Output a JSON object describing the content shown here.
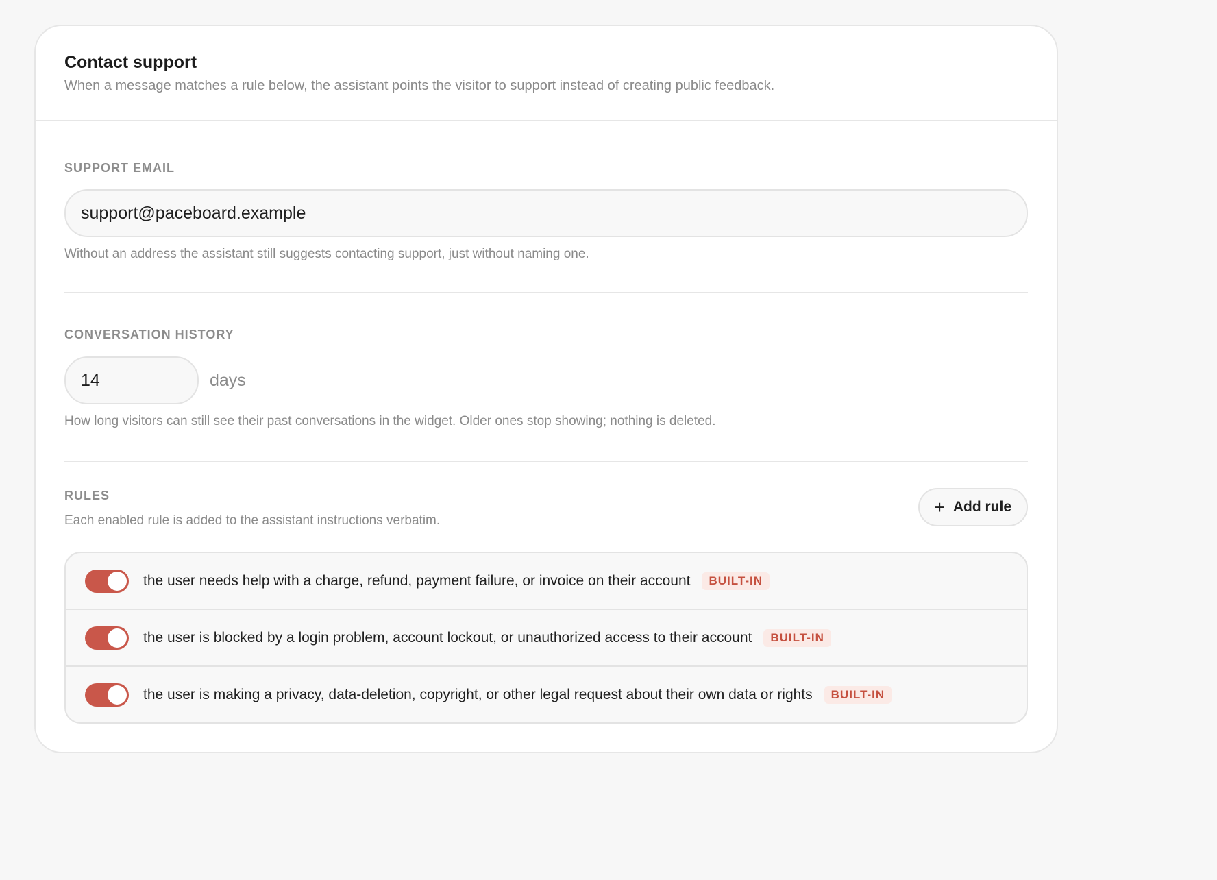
{
  "header": {
    "title": "Contact support",
    "subtitle": "When a message matches a rule below, the assistant points the visitor to support instead of creating public feedback."
  },
  "support_email": {
    "label": "SUPPORT EMAIL",
    "value": "support@paceboard.example",
    "help": "Without an address the assistant still suggests contacting support, just without naming one."
  },
  "history": {
    "label": "CONVERSATION HISTORY",
    "value": "14",
    "unit": "days",
    "help": "How long visitors can still see their past conversations in the widget. Older ones stop showing; nothing is deleted."
  },
  "rules": {
    "label": "RULES",
    "help": "Each enabled rule is added to the assistant instructions verbatim.",
    "add_label": "Add rule",
    "accent_color": "#c9574a",
    "items": [
      {
        "text": "the user needs help with a charge, refund, payment failure, or invoice on their account",
        "badge": "BUILT-IN",
        "enabled": true
      },
      {
        "text": "the user is blocked by a login problem, account lockout, or unauthorized access to their account",
        "badge": "BUILT-IN",
        "enabled": true
      },
      {
        "text": "the user is making a privacy, data-deletion, copyright, or other legal request about their own data or rights",
        "badge": "BUILT-IN",
        "enabled": true
      }
    ]
  }
}
